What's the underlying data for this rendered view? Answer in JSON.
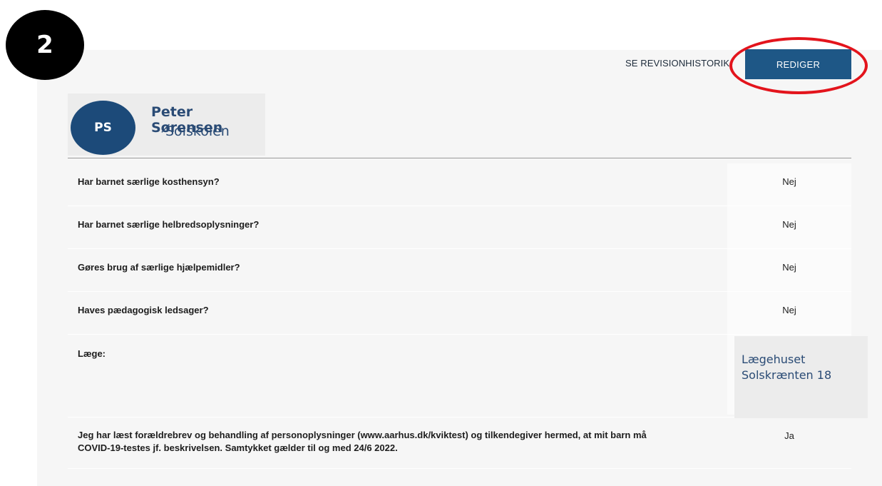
{
  "step_badge": "2",
  "toolbar": {
    "history_label": "SE REVISIONHISTORIK",
    "edit_label": "REDIGER"
  },
  "profile": {
    "initials": "PS",
    "name": "Peter Sørensen",
    "school": "Solskolen"
  },
  "rows": [
    {
      "question": "Har barnet særlige kosthensyn?",
      "answer": "Nej"
    },
    {
      "question": "Har barnet særlige helbredsoplysninger?",
      "answer": "Nej"
    },
    {
      "question": "Gøres brug af særlige hjælpemidler?",
      "answer": "Nej"
    },
    {
      "question": "Haves pædagogisk ledsager?",
      "answer": "Nej"
    },
    {
      "question": "Læge:",
      "answer_line1": "Lægehuset",
      "answer_line2": "Solskrænten 18"
    },
    {
      "question_line1": "Jeg har læst forældrebrev og behandling af personoplysninger (www.aarhus.dk/kviktest) og tilkendegiver hermed, at mit barn må",
      "question_line2": "COVID-19-testes jf. beskrivelsen. Samtykket gælder til og med 24/6 2022.",
      "answer": "Ja"
    }
  ],
  "colors": {
    "accent": "#1e5786",
    "avatar": "#1c4a79",
    "highlight": "#e3141c",
    "name_text": "#2a4b75"
  }
}
